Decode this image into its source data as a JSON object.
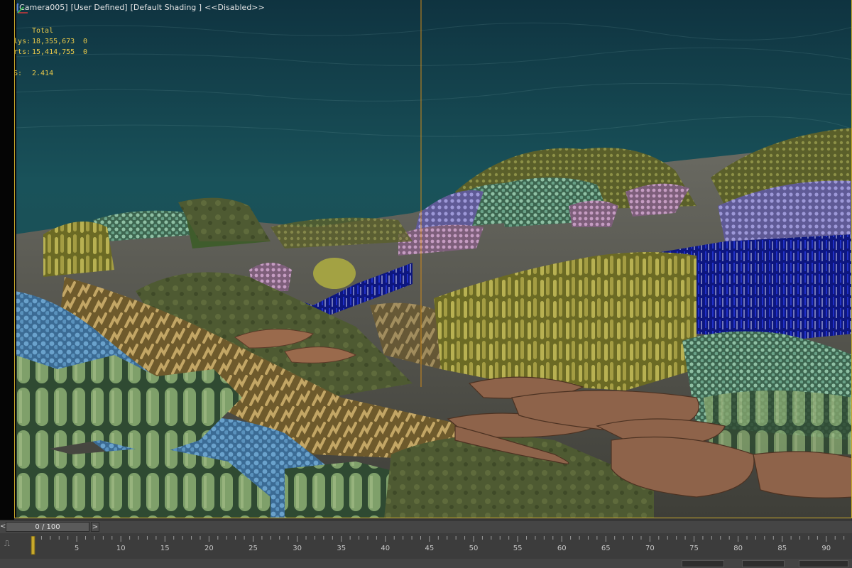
{
  "viewport": {
    "label_plus": "[+]",
    "label_camera": "[Camera005]",
    "label_view": "[User Defined]",
    "label_shading": "[Default Shading ]",
    "label_disabled": "<<Disabled>>"
  },
  "stats": {
    "header": "Total",
    "polys_label": "Polys:",
    "polys_value": "18,355,673",
    "polys_sel": "0",
    "verts_label": "Verts:",
    "verts_value": "15,414,755",
    "verts_sel": "0",
    "fps_label": "FPS:",
    "fps_value": "2.414"
  },
  "timeline": {
    "slider_text": "0 / 100",
    "prev_arrow": "<",
    "next_arrow": ">",
    "ticks": [
      0,
      5,
      10,
      15,
      20,
      25,
      30,
      35,
      40,
      45,
      50,
      55,
      60,
      65,
      70,
      75,
      80,
      85,
      90
    ],
    "labels": [
      "5",
      "10",
      "15",
      "20",
      "25",
      "30",
      "35",
      "40",
      "45",
      "50",
      "55",
      "60",
      "65",
      "70",
      "75",
      "80",
      "85",
      "90"
    ]
  },
  "colors": {
    "water_top": "#123a44",
    "water_mid": "#1d5558",
    "border_accent": "#c9a92b",
    "stats_text": "#e8c84a",
    "selection_blue": "#101c9e"
  }
}
